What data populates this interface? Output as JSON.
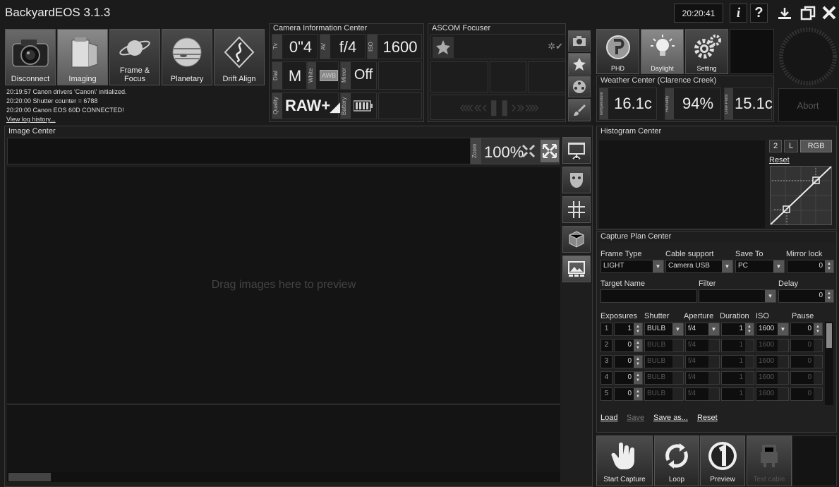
{
  "app": {
    "title": "BackyardEOS 3.1.3",
    "clock": "20:20:41"
  },
  "titlebar": {
    "info": "i",
    "help": "?"
  },
  "nav": [
    {
      "label": "Disconnect"
    },
    {
      "label": "Imaging"
    },
    {
      "label": "Frame &\nFocus"
    },
    {
      "label": "Planetary"
    },
    {
      "label": "Drift Align"
    }
  ],
  "log": {
    "lines": [
      "20:19:57  Canon drivers 'Canon\\' initialized.",
      "20:20:00  Shutter counter = 6788",
      "20:20:00  Canon EOS 60D CONNECTED!"
    ],
    "link": "View log history..."
  },
  "camera": {
    "title": "Camera Information Center",
    "tv_label": "Tv",
    "tv": "0\"4",
    "av_label": "AV",
    "av": "f/4",
    "iso_label": "ISO",
    "iso": "1600",
    "dial_label": "Dial",
    "dial": "M",
    "white_label": "White",
    "wb": "AWB",
    "mirror_label": "Mirror",
    "mirror": "Off",
    "quality_label": "Quality",
    "quality": "RAW+◢L",
    "battery_label": "Battery"
  },
  "ascom": {
    "title": "ASCOM Focuser"
  },
  "tools": [
    {
      "label": "PHD"
    },
    {
      "label": "Daylight"
    },
    {
      "label": "Setting"
    }
  ],
  "weather": {
    "title": "Weather Center (Clarence Creek)",
    "temp_label": "Temperature",
    "temp": "16.1c",
    "hum_label": "Humidity",
    "hum": "94%",
    "dew_label": "Dew Point",
    "dew": "15.1c"
  },
  "abort": "Abort",
  "image": {
    "title": "Image Center",
    "zoom_label": "Zoom",
    "zoom": "100%",
    "placeholder": "Drag images here to preview"
  },
  "histogram": {
    "title": "Histogram Center",
    "btn2": "2",
    "btnL": "L",
    "btnRGB": "RGB",
    "reset": "Reset"
  },
  "plan": {
    "title": "Capture Plan Center",
    "frame_type_label": "Frame Type",
    "frame_type": "LIGHT",
    "cable_label": "Cable support",
    "cable": "Camera USB",
    "save_label": "Save To",
    "save": "PC",
    "mirror_label": "Mirror lock",
    "mirror": "0",
    "target_label": "Target Name",
    "filter_label": "Filter",
    "delay_label": "Delay",
    "delay": "0",
    "cols": {
      "exposures": "Exposures",
      "shutter": "Shutter",
      "aperture": "Aperture",
      "duration": "Duration",
      "iso": "ISO",
      "pause": "Pause"
    },
    "rows": [
      {
        "n": "1",
        "exp": "1",
        "shutter": "BULB",
        "aperture": "f/4",
        "duration": "1",
        "iso": "1600",
        "pause": "0"
      },
      {
        "n": "2",
        "exp": "0",
        "shutter": "BULB",
        "aperture": "f/4",
        "duration": "1",
        "iso": "1600",
        "pause": "0"
      },
      {
        "n": "3",
        "exp": "0",
        "shutter": "BULB",
        "aperture": "f/4",
        "duration": "1",
        "iso": "1600",
        "pause": "0"
      },
      {
        "n": "4",
        "exp": "0",
        "shutter": "BULB",
        "aperture": "f/4",
        "duration": "1",
        "iso": "1600",
        "pause": "0"
      },
      {
        "n": "5",
        "exp": "0",
        "shutter": "BULB",
        "aperture": "f/4",
        "duration": "1",
        "iso": "1600",
        "pause": "0"
      }
    ],
    "links": {
      "load": "Load",
      "save": "Save",
      "save_as": "Save as...",
      "reset": "Reset"
    }
  },
  "actions": [
    {
      "label": "Start Capture"
    },
    {
      "label": "Loop"
    },
    {
      "label": "Preview"
    },
    {
      "label": "Test cable"
    }
  ]
}
